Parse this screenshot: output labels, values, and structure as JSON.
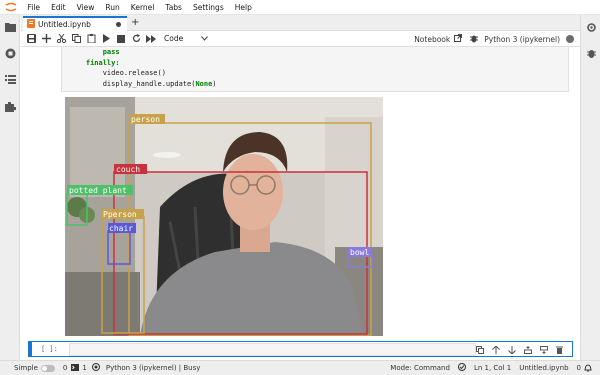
{
  "menubar": {
    "items": [
      "File",
      "Edit",
      "View",
      "Run",
      "Kernel",
      "Tabs",
      "Settings",
      "Help"
    ]
  },
  "tab": {
    "title": "Untitled.ipynb",
    "new_tab": "+"
  },
  "toolbar": {
    "cell_type": "Code",
    "notebook_label": "Notebook",
    "kernel_name": "Python 3 (ipykernel)"
  },
  "code_cell": {
    "lines": [
      {
        "indent": "        ",
        "kw": "pass",
        "text": ""
      },
      {
        "indent": "    ",
        "kw": "finally:",
        "text": ""
      },
      {
        "indent": "        ",
        "kw": "",
        "text": "video.release()"
      },
      {
        "indent": "        ",
        "kw": "",
        "text": "display_handle.update(",
        "const": "None",
        "tail": ")"
      }
    ]
  },
  "detections": [
    {
      "label": "person",
      "color": "#c8a24a"
    },
    {
      "label": "couch",
      "color": "#c8323c"
    },
    {
      "label": "potted plant",
      "color": "#4fbf6a"
    },
    {
      "label": "Pperson",
      "color": "#c8a24a"
    },
    {
      "label": "chair",
      "color": "#5a5ad6"
    },
    {
      "label": "bowl",
      "color": "#8a7ae0"
    }
  ],
  "active_cell": {
    "prompt": "[ ]:"
  },
  "statusbar": {
    "mode_label": "Simple",
    "terminals": "0",
    "kernels": "1",
    "kernel_status": "Python 3 (ipykernel) | Busy",
    "mode": "Mode: Command",
    "position": "Ln 1, Col 1",
    "filename": "Untitled.ipynb",
    "notifications": "0"
  },
  "colors": {
    "accent": "#1976d2",
    "keyword": "#008000"
  }
}
